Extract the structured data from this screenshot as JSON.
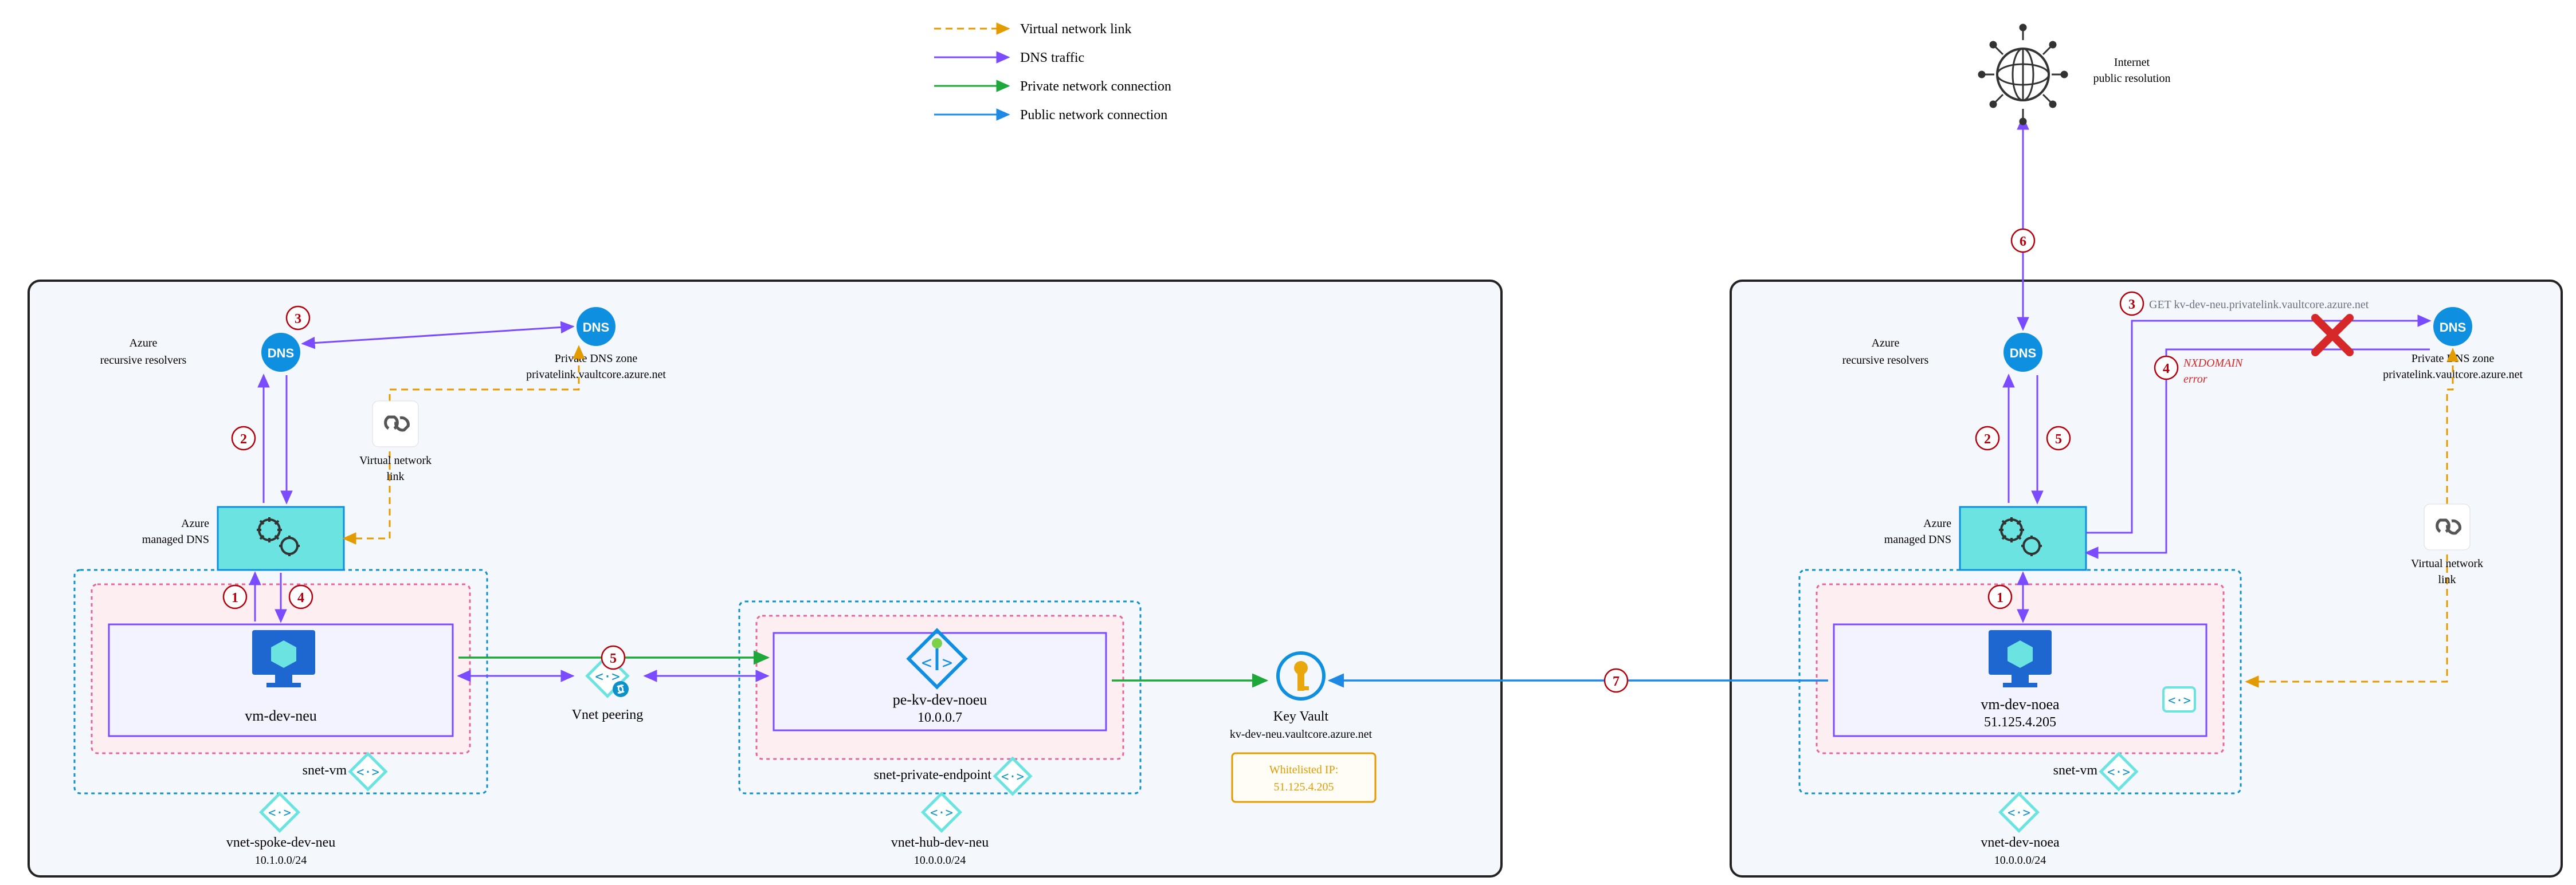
{
  "legend": {
    "vlink": "Virtual network link",
    "dns": "DNS traffic",
    "priv": "Private network connection",
    "pub": "Public network connection"
  },
  "colors": {
    "vlink": "#e29b00",
    "dns": "#7b4cff",
    "priv": "#1ea83a",
    "pub": "#1e88e5",
    "step": "#b3000c",
    "textDark": "#333",
    "textMuted": "#6b7280",
    "subnetFill": "#fdeef1",
    "subnetStroke": "#e3679b",
    "region": "#f4f7fb",
    "vmBlue": "#1e66d0",
    "azureBlue": "#0f8fe0",
    "teal": "#6be3e0",
    "keyvault": "#e8a80d"
  },
  "labels": {
    "internet1": "Internet",
    "internet2": "public resolution",
    "azureRecursive": "Azure",
    "azureRecursive2": "recursive resolvers",
    "pdnsZone1": "Private DNS zone",
    "pdnsZone2": "privatelink.vaultcore.azure.net",
    "vnetLink1": "Virtual network",
    "vnetLink2": "link",
    "azureManaged": "Azure",
    "azureManaged2": "managed DNS",
    "snetVm": "snet-vm",
    "snetPE": "snet-private-endpoint",
    "vnetPeering": "Vnet peering",
    "vmLeft": "vm-dev-neu",
    "pe1": "pe-kv-dev-noeu",
    "peIp": "10.0.0.7",
    "kv1": "Key Vault",
    "kv2": "kv-dev-neu.vaultcore.azure.net",
    "whitelist1": "Whitelisted IP:",
    "whitelist2": "51.125.4.205",
    "vnetSpoke1": "vnet-spoke-dev-neu",
    "vnetSpoke2": "10.1.0.0/24",
    "vnetHub1": "vnet-hub-dev-neu",
    "vnetHub2": "10.0.0.0/24",
    "vnetRight1": "vnet-dev-noea",
    "vnetRight2": "10.0.0.0/24",
    "vmRight1": "vm-dev-noea",
    "vmRight2": "51.125.4.205",
    "getReq": "GET kv-dev-neu.privatelink.vaultcore.azure.net",
    "nx1": "NXDOMAIN",
    "nx2": "error"
  },
  "steps": {
    "s1": "1",
    "s2": "2",
    "s3": "3",
    "s4": "4",
    "s5": "5",
    "s6": "6",
    "s7": "7"
  }
}
